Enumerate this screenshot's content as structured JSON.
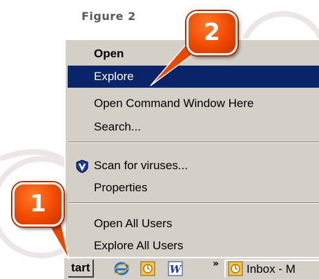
{
  "figure_label": "Figure 2",
  "menu": {
    "items": [
      {
        "label": "Open"
      },
      {
        "label": "Explore"
      },
      {
        "label": "Open Command Window Here"
      },
      {
        "label": "Search..."
      },
      {
        "label": "Scan for viruses..."
      },
      {
        "label": "Properties"
      },
      {
        "label": "Open All Users"
      },
      {
        "label": "Explore All Users"
      }
    ],
    "selected_index": 1
  },
  "taskbar": {
    "start_label": "tart",
    "overflow_glyph": "»",
    "inbox_label": "Inbox - M"
  },
  "callouts": [
    {
      "number": "1"
    },
    {
      "number": "2"
    }
  ],
  "colors": {
    "menu_bg": "#d4d0c8",
    "selected_bg": "#0a246a",
    "callout_orange": "#f04a00"
  },
  "icons": {
    "scan": "shield-icon",
    "taskbar": [
      "internet-explorer-icon",
      "clock-icon",
      "word-icon",
      "clock-icon"
    ]
  }
}
